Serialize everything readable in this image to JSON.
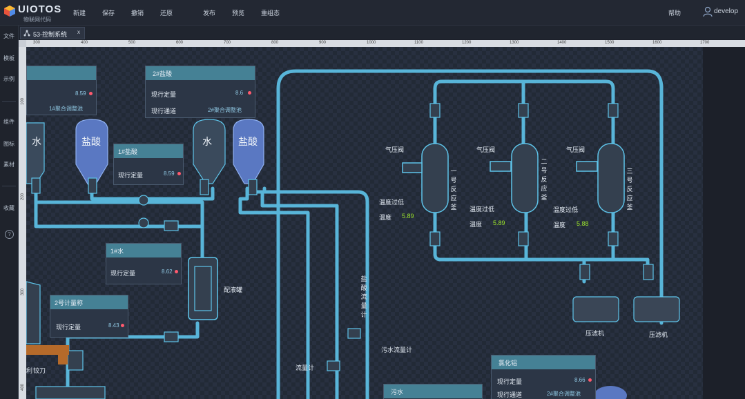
{
  "app": {
    "logo_text": "UIOTOS",
    "logo_sub": "物联网代码"
  },
  "menu": {
    "items": [
      "新建",
      "保存",
      "撤销",
      "还原",
      "发布",
      "预览",
      "重组态"
    ],
    "help": "帮助",
    "user": "develop"
  },
  "sidebar": {
    "items": [
      "文件",
      "模板",
      "示例",
      "组件",
      "图标",
      "素材",
      "收藏"
    ],
    "help_icon": "?"
  },
  "tab": {
    "label": "53-控制系统",
    "close": "x"
  },
  "ruler": {
    "h_ticks": [
      "300",
      "400",
      "500",
      "600",
      "700",
      "800",
      "900",
      "1000",
      "1100",
      "1200",
      "1300",
      "1400",
      "1500",
      "1600",
      "1700"
    ],
    "v_ticks": [
      "100",
      "200",
      "300",
      "400"
    ]
  },
  "tanks": {
    "water": "水",
    "acid": "盐酸"
  },
  "panels": {
    "p1": {
      "value": "8.59",
      "channel": "1#聚合调整池"
    },
    "p2": {
      "title": "2#盐酸",
      "row1": "现行定量",
      "value": "8.6",
      "row2": "现行通道",
      "channel": "2#聚合调整池"
    },
    "p3": {
      "title": "1#盐酸",
      "row1": "现行定量",
      "value": "8.59"
    },
    "p4": {
      "title": "1#水",
      "row1": "现行定量",
      "value": "8.62"
    },
    "p5": {
      "title": "2号计量称",
      "row1": "现行定量",
      "value": "8.43"
    },
    "p6": {
      "title": "氯化铝",
      "row1": "现行定量",
      "value": "8.66",
      "row2": "现行通道",
      "channel": "2#聚合调整池"
    },
    "p7": {
      "title": "污水"
    }
  },
  "labels": {
    "mixing_tank": "配液罐",
    "flow_meter_v": "盐酸流量计",
    "flow_meter": "流量计",
    "sewage_flow": "污水流量计",
    "reactor1": "一号反应釜",
    "reactor2": "二号反应釜",
    "reactor3": "三号反应釜",
    "pressure_valve": "气压阀",
    "temp_low": "温度过低",
    "temp": "温度",
    "temp_value": "5.89",
    "temp_value3": "5.88",
    "compressor": "压滤机",
    "hinge": "铰刀",
    "hinge_prefix": "利"
  },
  "colors": {
    "pipe": "#5ec4ea",
    "accent_green": "#9be22d",
    "alarm": "#ff5a6e"
  }
}
